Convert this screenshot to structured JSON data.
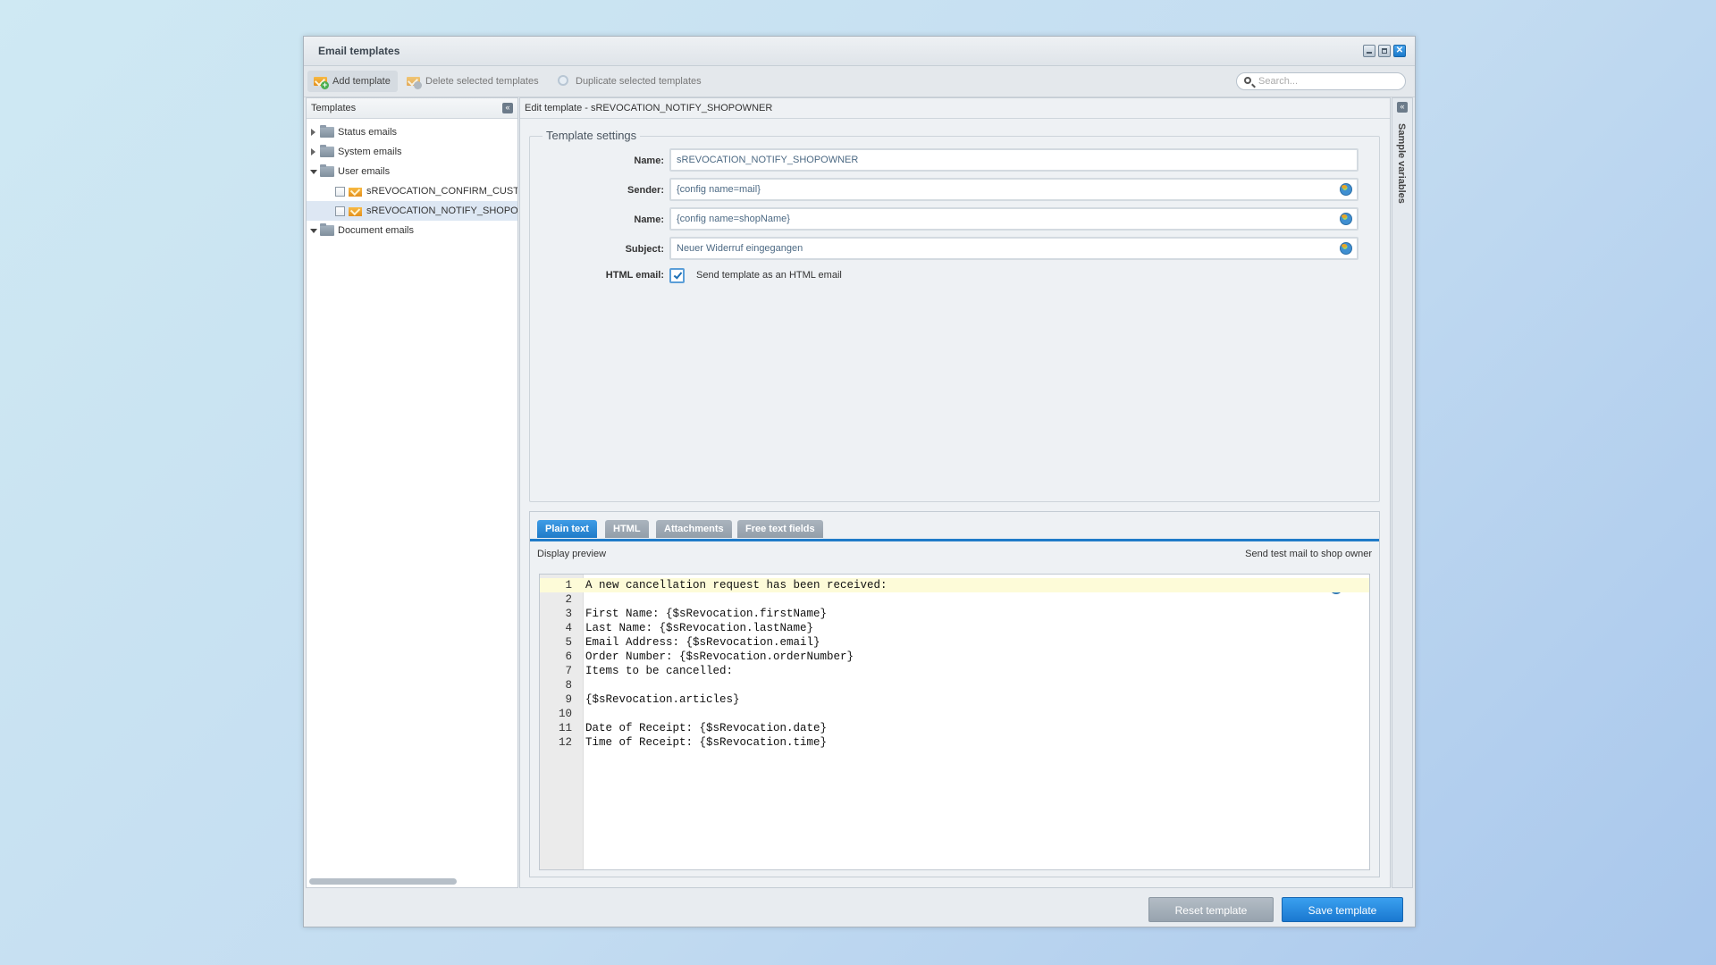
{
  "window": {
    "title": "Email templates"
  },
  "toolbar": {
    "add_label": "Add template",
    "delete_label": "Delete selected templates",
    "duplicate_label": "Duplicate selected templates",
    "search_placeholder": "Search..."
  },
  "tree": {
    "header": "Templates",
    "items": [
      {
        "label": "Status emails",
        "type": "folder",
        "state": "collapsed"
      },
      {
        "label": "System emails",
        "type": "folder",
        "state": "collapsed"
      },
      {
        "label": "User emails",
        "type": "folder",
        "state": "expanded"
      },
      {
        "label": "sREVOCATION_CONFIRM_CUST",
        "type": "template",
        "level": 2
      },
      {
        "label": "sREVOCATION_NOTIFY_SHOPO",
        "type": "template",
        "level": 2,
        "selected": true
      },
      {
        "label": "Document emails",
        "type": "folder",
        "state": "expanded"
      }
    ]
  },
  "editor_header": "Edit template - sREVOCATION_NOTIFY_SHOPOWNER",
  "settings": {
    "legend": "Template settings",
    "name_label": "Name:",
    "name_value": "sREVOCATION_NOTIFY_SHOPOWNER",
    "sender_label": "Sender:",
    "sender_value": "{config name=mail}",
    "sender_name_label": "Name:",
    "sender_name_value": "{config name=shopName}",
    "subject_label": "Subject:",
    "subject_value": "Neuer Widerruf eingegangen",
    "html_label": "HTML email:",
    "html_checked": true,
    "html_text": "Send template as an HTML email"
  },
  "tabs": [
    {
      "label": "Plain text",
      "active": true
    },
    {
      "label": "HTML"
    },
    {
      "label": "Attachments"
    },
    {
      "label": "Free text fields"
    }
  ],
  "subbar": {
    "preview": "Display preview",
    "test_mail": "Send test mail to shop owner"
  },
  "code": {
    "lines": [
      {
        "n": "1",
        "text": "A new cancellation request has been received:"
      },
      {
        "n": "2",
        "text": ""
      },
      {
        "n": "3",
        "text": "First Name: {$sRevocation.firstName}"
      },
      {
        "n": "4",
        "text": "Last Name: {$sRevocation.lastName}"
      },
      {
        "n": "5",
        "text": "Email Address: {$sRevocation.email}"
      },
      {
        "n": "6",
        "text": "Order Number: {$sRevocation.orderNumber}"
      },
      {
        "n": "7",
        "text": "Items to be cancelled:"
      },
      {
        "n": "8",
        "text": ""
      },
      {
        "n": "9",
        "text": "{$sRevocation.articles}"
      },
      {
        "n": "10",
        "text": ""
      },
      {
        "n": "11",
        "text": "Date of Receipt: {$sRevocation.date}"
      },
      {
        "n": "12",
        "text": "Time of Receipt: {$sRevocation.time}"
      }
    ]
  },
  "side_panel": {
    "label": "Sample variables"
  },
  "footer": {
    "reset_label": "Reset template",
    "save_label": "Save template"
  },
  "icons": {
    "add": "add-template-icon",
    "delete": "delete-template-icon",
    "duplicate": "duplicate-icon",
    "search": "search-icon",
    "folder": "folder-icon",
    "mail": "mail-icon",
    "translate": "globe-icon"
  },
  "colors": {
    "accent": "#1f7bc8",
    "button_primary": "#1a78d0",
    "button_secondary": "#97a3ae"
  }
}
